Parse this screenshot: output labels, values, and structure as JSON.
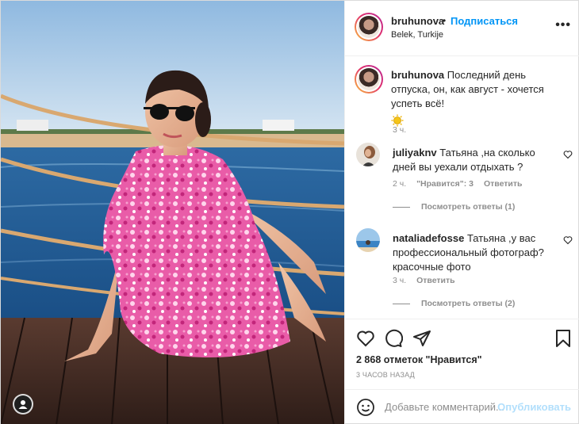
{
  "header": {
    "username": "bruhunova",
    "dot": "•",
    "follow_label": "Подписаться",
    "location": "Belek, Turkije",
    "more_icon": "more-horizontal-icon"
  },
  "caption": {
    "username": "bruhunova",
    "text": "Последний день отпуска, он, как август - хочется успеть всё!",
    "emoji": "sun-icon",
    "time": "3 ч."
  },
  "comments": [
    {
      "username": "juliyaknv",
      "text": "Татьяна ,на сколько дней вы уехали отдыхать ?",
      "time": "2 ч.",
      "likes": "\"Нравится\": 3",
      "reply": "Ответить",
      "view_replies": "Посмотреть ответы (1)"
    },
    {
      "username": "nataliadefosse",
      "text": "Татьяна ,у вас профессиональный фотограф? красочные фото",
      "time": "3 ч.",
      "reply": "Ответить",
      "view_replies": "Посмотреть ответы (2)"
    }
  ],
  "actions": {
    "likes_text": "2 868 отметок \"Нравится\"",
    "time_ago": "3 ЧАСОВ НАЗАД"
  },
  "add_comment": {
    "placeholder": "Добавьте комментарий...",
    "publish_label": "Опубликовать"
  },
  "colors": {
    "accent": "#0095f6",
    "publish_disabled": "#b2dffc",
    "secondary_text": "#8e8e8e"
  }
}
